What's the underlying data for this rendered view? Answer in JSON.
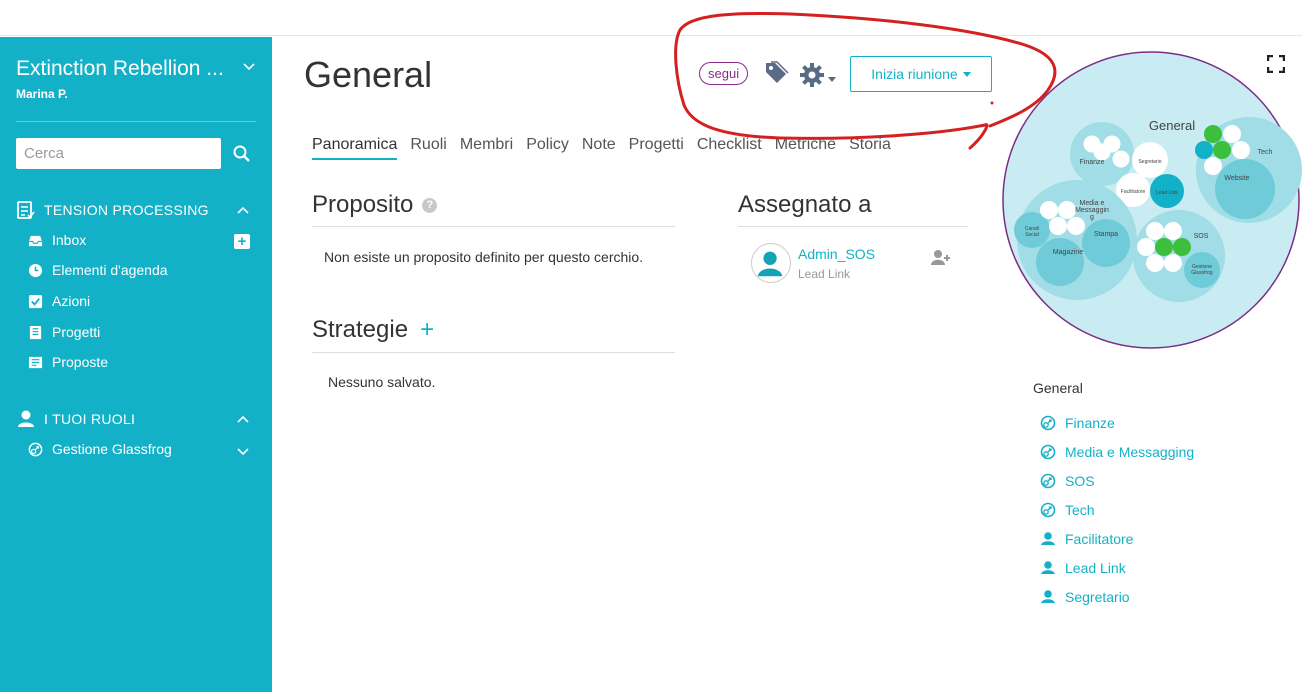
{
  "sidebar": {
    "org_name": "Extinction Rebellion ...",
    "user_name": "Marina P.",
    "search_placeholder": "Cerca",
    "tension_section": {
      "label": "TENSION PROCESSING",
      "icon": "checklist-icon"
    },
    "tension_items": [
      {
        "label": "Inbox",
        "icon": "inbox-icon"
      },
      {
        "label": "Elementi d'agenda",
        "icon": "clock-icon"
      },
      {
        "label": "Azioni",
        "icon": "checkbox-icon"
      },
      {
        "label": "Progetti",
        "icon": "project-icon"
      },
      {
        "label": "Proposte",
        "icon": "proposal-icon"
      }
    ],
    "roles_section": {
      "label": "I TUOI RUOLI",
      "icon": "person-icon"
    },
    "roles_items": [
      {
        "label": "Gestione Glassfrog",
        "icon": "circle-role-icon"
      }
    ]
  },
  "header": {
    "title": "General",
    "follow_label": "segui",
    "meeting_button": "Inizia riunione"
  },
  "tabs": [
    "Panoramica",
    "Ruoli",
    "Membri",
    "Policy",
    "Note",
    "Progetti",
    "Checklist",
    "Metriche",
    "Storia"
  ],
  "purpose": {
    "heading": "Proposito",
    "text": "Non esiste un proposito definito per questo cerchio."
  },
  "strategies": {
    "heading": "Strategie",
    "add_symbol": "+",
    "empty_text": "Nessuno salvato."
  },
  "assigned": {
    "heading": "Assegnato a",
    "name": "Admin_SOS",
    "role": "Lead Link"
  },
  "circle_map": {
    "root": "General",
    "labels": {
      "finanze": "Finanze",
      "segretario": "Segretario",
      "facilitatore": "Facilitatore",
      "lead_link": "Lead Link",
      "tech": "Tech",
      "website": "Website",
      "media_line1": "Media e",
      "media_line2": "Messaggin",
      "media_line3": "g",
      "canali_line1": "Canali",
      "canali_line2": "Social",
      "stampa": "Stampa",
      "magazine": "Magazine",
      "sos": "SOS",
      "gestione_line1": "Gestione",
      "gestione_line2": "Glassfrog"
    },
    "colors": {
      "outer_border": "#7b2d86",
      "background": "#c8ecf1",
      "circle": "#a0dde6",
      "inner": "#6fcbd8",
      "filled_role": "#13b1c7",
      "green": "#3cbf3c"
    }
  },
  "side_list": {
    "heading": "General",
    "items": [
      {
        "label": "Finanze",
        "icon": "circle-icon"
      },
      {
        "label": "Media e Messagging",
        "icon": "circle-icon"
      },
      {
        "label": "SOS",
        "icon": "circle-icon"
      },
      {
        "label": "Tech",
        "icon": "circle-icon"
      },
      {
        "label": "Facilitatore",
        "icon": "person-icon"
      },
      {
        "label": "Lead Link",
        "icon": "person-icon"
      },
      {
        "label": "Segretario",
        "icon": "person-icon"
      }
    ]
  },
  "colors": {
    "accent": "#13b1c7",
    "follow": "#8b2a8b",
    "annotation": "#d42020"
  }
}
